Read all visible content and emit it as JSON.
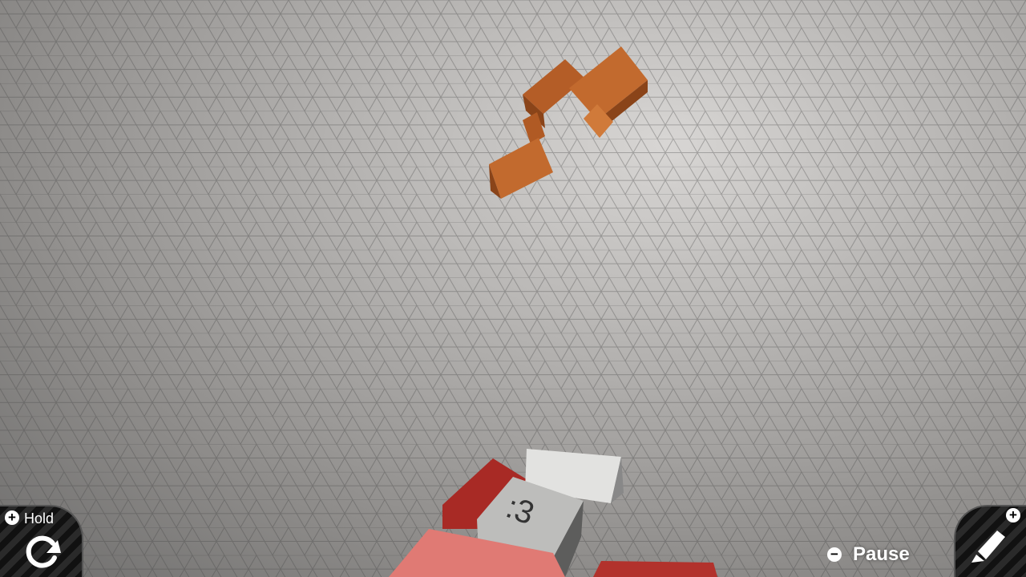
{
  "hud": {
    "hold_button": {
      "label": "Hold",
      "icon": "rotate-cw-icon",
      "badge": "plus-button-icon"
    },
    "pause_button": {
      "label": "Pause",
      "badge": "minus-button-icon"
    },
    "draw_button": {
      "icon": "pencil-icon",
      "badge": "plus-button-icon"
    }
  },
  "colors": {
    "crate": "#c0652a",
    "red_block": "#c8413c",
    "white_block": "#e6e6e4"
  },
  "scene": {
    "face_block_text": ":3"
  }
}
